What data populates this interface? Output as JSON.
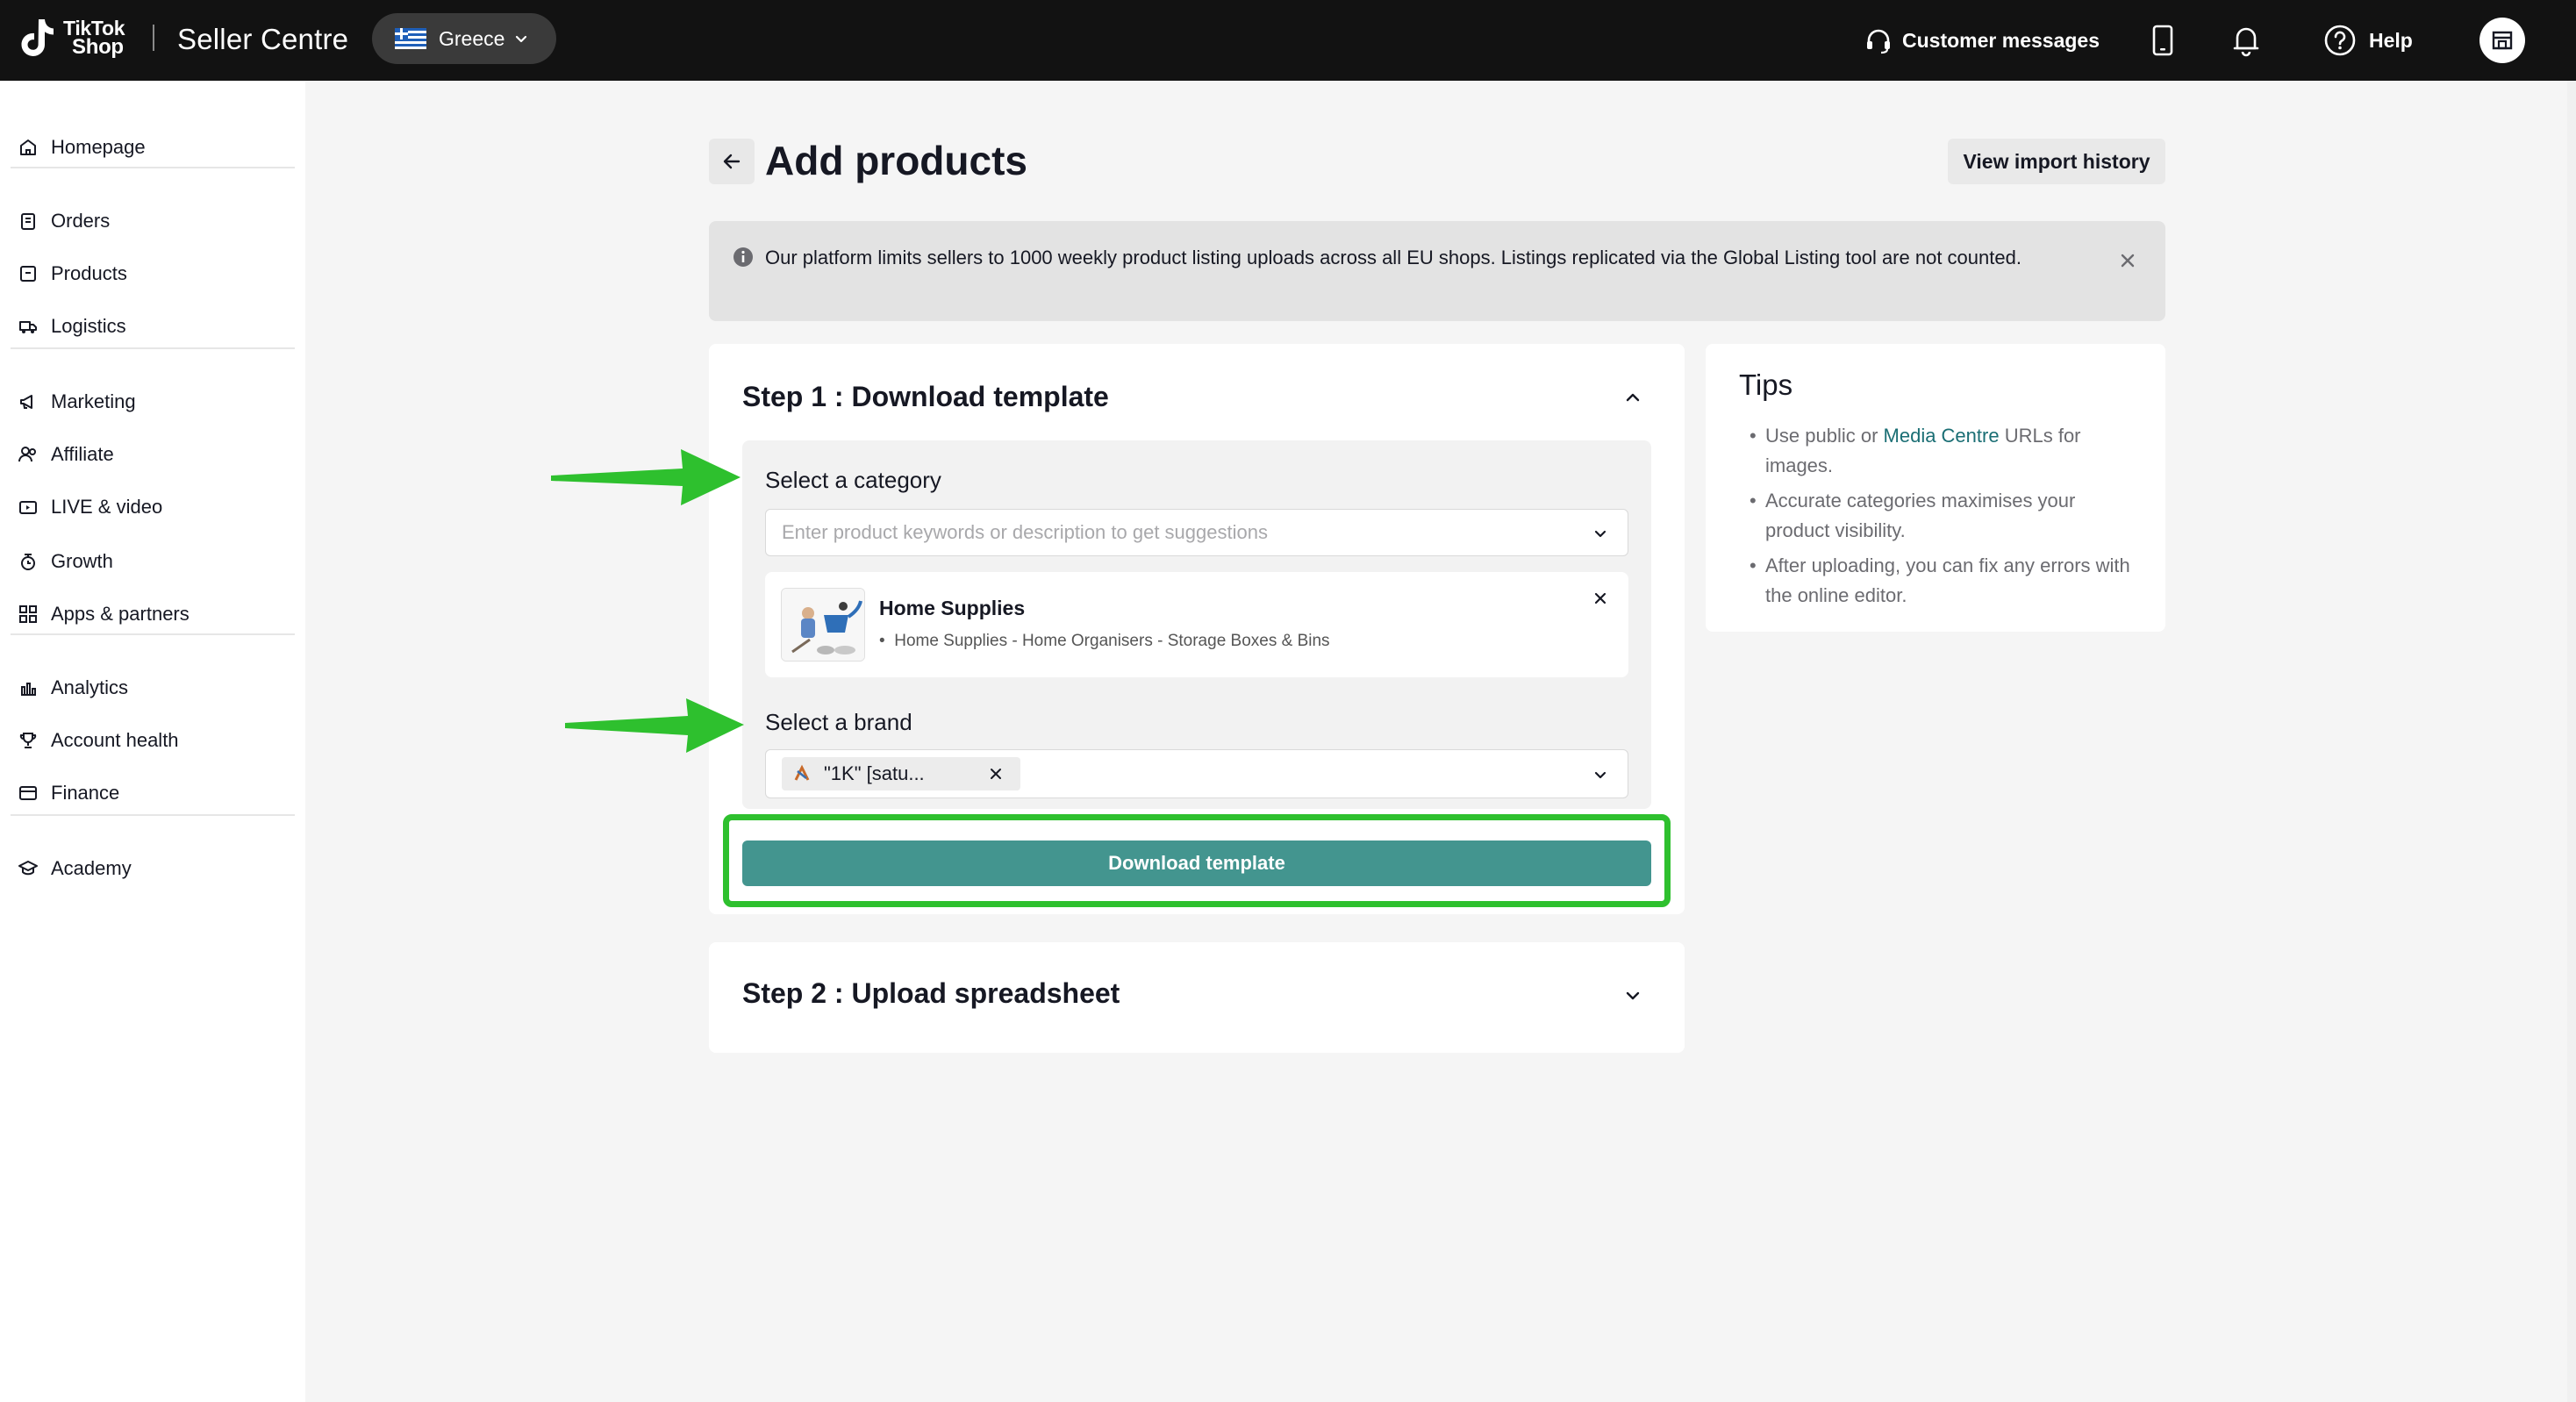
{
  "topbar": {
    "brand_line1": "TikTok",
    "brand_line2": "Shop",
    "app_title": "Seller Centre",
    "region": "Greece",
    "customer_messages": "Customer messages",
    "help": "Help"
  },
  "sidebar": {
    "items": [
      {
        "label": "Homepage",
        "icon": "home-icon"
      },
      {
        "label": "Orders",
        "icon": "orders-icon"
      },
      {
        "label": "Products",
        "icon": "products-icon"
      },
      {
        "label": "Logistics",
        "icon": "truck-icon"
      },
      {
        "label": "Marketing",
        "icon": "megaphone-icon"
      },
      {
        "label": "Affiliate",
        "icon": "affiliate-icon"
      },
      {
        "label": "LIVE & video",
        "icon": "video-icon"
      },
      {
        "label": "Growth",
        "icon": "growth-icon"
      },
      {
        "label": "Apps & partners",
        "icon": "apps-icon"
      },
      {
        "label": "Analytics",
        "icon": "analytics-icon"
      },
      {
        "label": "Account health",
        "icon": "trophy-icon"
      },
      {
        "label": "Finance",
        "icon": "finance-icon"
      },
      {
        "label": "Academy",
        "icon": "academy-icon"
      }
    ]
  },
  "page": {
    "title": "Add products",
    "view_history": "View import history",
    "banner": "Our platform limits sellers to 1000 weekly product listing uploads across all EU shops. Listings replicated via the Global Listing tool are not counted."
  },
  "step1": {
    "title": "Step 1 : Download template",
    "category_label": "Select a category",
    "category_placeholder": "Enter product keywords or description to get suggestions",
    "selected_category_name": "Home Supplies",
    "selected_category_path": "Home Supplies - Home Organisers - Storage Boxes & Bins",
    "brand_label": "Select a brand",
    "brand_tag": "\"1K\" [satu...",
    "download_button": "Download template"
  },
  "step2": {
    "title": "Step 2 : Upload spreadsheet"
  },
  "tips": {
    "title": "Tips",
    "tip1_pre": "Use public or ",
    "tip1_link": "Media Centre",
    "tip1_post": " URLs for images.",
    "tip2": "Accurate categories maximises your product visibility.",
    "tip3": "After uploading, you can fix any errors with the online editor."
  },
  "colors": {
    "topbar": "#121212",
    "accent_teal": "#43958f",
    "highlight_green": "#2ec02e",
    "link": "#1a6e74"
  }
}
